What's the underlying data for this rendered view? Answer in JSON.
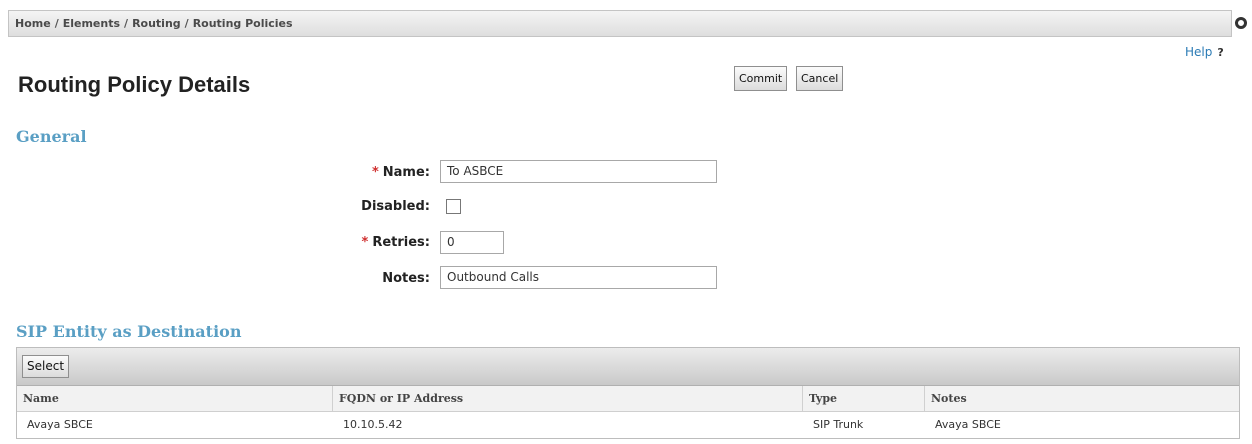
{
  "breadcrumb": [
    "Home",
    "Elements",
    "Routing",
    "Routing Policies"
  ],
  "help": {
    "label": "Help",
    "mark": "?"
  },
  "page_title": "Routing Policy Details",
  "buttons": {
    "commit": "Commit",
    "cancel": "Cancel"
  },
  "general": {
    "title": "General",
    "fields": {
      "name": {
        "required_mark": "*",
        "label": "Name:",
        "value": "To ASBCE"
      },
      "disabled": {
        "label": "Disabled:",
        "checked": false
      },
      "retries": {
        "required_mark": "*",
        "label": "Retries:",
        "value": "0"
      },
      "notes": {
        "label": "Notes:",
        "value": "Outbound Calls"
      }
    }
  },
  "destination": {
    "title": "SIP Entity as Destination",
    "select_label": "Select",
    "columns": [
      "Name",
      "FQDN or IP Address",
      "Type",
      "Notes"
    ],
    "rows": [
      {
        "name": "Avaya SBCE",
        "fqdn": "10.10.5.42",
        "type": "SIP Trunk",
        "notes": "Avaya SBCE"
      }
    ]
  }
}
